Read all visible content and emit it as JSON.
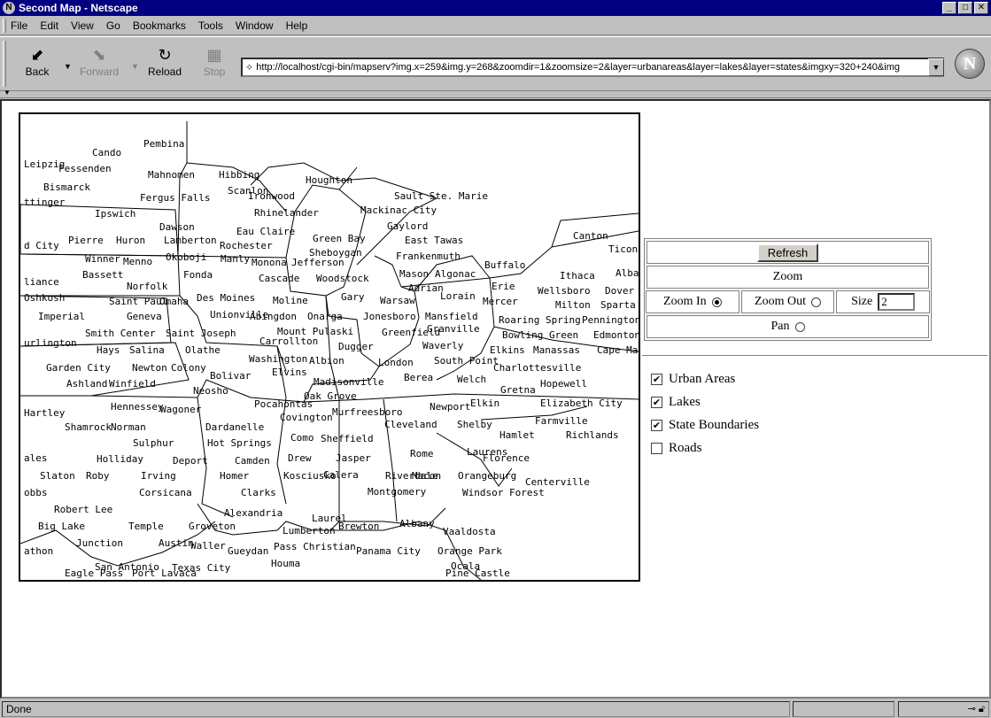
{
  "window": {
    "title": "Second Map - Netscape",
    "minimize": "_",
    "maximize": "□",
    "close": "✕"
  },
  "menu": {
    "file": "File",
    "edit": "Edit",
    "view": "View",
    "go": "Go",
    "bookmarks": "Bookmarks",
    "tools": "Tools",
    "window": "Window",
    "help": "Help"
  },
  "toolbar": {
    "back": "Back",
    "forward": "Forward",
    "reload": "Reload",
    "stop": "Stop",
    "url": "http://localhost/cgi-bin/mapserv?img.x=259&img.y=268&zoomdir=1&zoomsize=2&layer=urbanareas&layer=lakes&layer=states&imgxy=320+240&img"
  },
  "map": {
    "labels": [
      "Pembina",
      "Cando",
      "Leipzig",
      "Fessenden",
      "Mahnomen",
      "Hibbing",
      "Houghton",
      "Bismarck",
      "Fergus Falls",
      "Scanlon",
      "Ironwood",
      "Sault Ste. Marie",
      "ttinger",
      "Ipswich",
      "Rhinelander",
      "Mackinac City",
      "Dawson",
      "Eau Claire",
      "Gaylord",
      "d City",
      "Pierre",
      "Huron",
      "Lamberton",
      "Rochester",
      "Green Bay",
      "East Tawas",
      "Canton",
      "Ticond",
      "Winner",
      "Menno",
      "Okoboji",
      "Manly",
      "Monona",
      "Jefferson",
      "Sheboygan",
      "Frankenmuth",
      "Bassett",
      "Fonda",
      "Cascade",
      "Woodstock",
      "Mason",
      "Algonac",
      "Buffalo",
      "Ithaca",
      "Alban",
      "liance",
      "Norfolk",
      "Adrian",
      "Erie",
      "Wellsboro",
      "Dover",
      "Oshkosh",
      "Saint Paul",
      "Omaha",
      "Des Moines",
      "Moline",
      "Gary",
      "Warsaw",
      "Lorain",
      "Mercer",
      "Milton",
      "Sparta",
      "Imperial",
      "Geneva",
      "Unionville",
      "Abingdon",
      "Onarga",
      "Jonesboro",
      "Mansfield",
      "Roaring Spring",
      "Pennington",
      "Smith Center",
      "Saint Joseph",
      "Mount Pulaski",
      "Greenfield",
      "Granville",
      "Bowling Green",
      "Edmonton",
      "urlington",
      "Hays",
      "Salina",
      "Olathe",
      "Carrollton",
      "Dugger",
      "Waverly",
      "Elkins",
      "Manassas",
      "Cape May",
      "Washington",
      "Albion",
      "London",
      "South Point",
      "Charlottesville",
      "Garden City",
      "Newton",
      "Colony",
      "Elvins",
      "Ashland",
      "Winfield",
      "Bolivar",
      "Madisonville",
      "Berea",
      "Welch",
      "Hopewell",
      "Neosho",
      "Oak Grove",
      "Gretna",
      "Hartley",
      "Hennessey",
      "Wagoner",
      "Pocahontas",
      "Covington",
      "Murfreesboro",
      "Newport",
      "Elkin",
      "Elizabeth City",
      "Shamrock",
      "Norman",
      "Dardanelle",
      "Cleveland",
      "Shelby",
      "Farmville",
      "Sulphur",
      "Hot Springs",
      "Como",
      "Sheffield",
      "Hamlet",
      "Richlands",
      "ales",
      "Holliday",
      "Deport",
      "Camden",
      "Drew",
      "Jasper",
      "Rome",
      "Laurens",
      "Florence",
      "Slaton",
      "Roby",
      "Irving",
      "Homer",
      "Kosciusko",
      "Calera",
      "Riverdale",
      "Macon",
      "Orangeburg",
      "Centerville",
      "obbs",
      "Corsicana",
      "Clarks",
      "Montgomery",
      "Windsor Forest",
      "Robert Lee",
      "Big Lake",
      "Temple",
      "Groveton",
      "Alexandria",
      "Laurel",
      "Brewton",
      "Albany",
      "Junction",
      "Lumberton",
      "Vaaldosta",
      "Austin",
      "Waller",
      "Gueydan",
      "Pass Christian",
      "Panama City",
      "Orange Park",
      "athon",
      "San Antonio",
      "Texas City",
      "Houma",
      "Ocala",
      "Eagle Pass",
      "Port Lavaca",
      "Pine Castle"
    ]
  },
  "controls": {
    "refresh": "Refresh",
    "zoom": "Zoom",
    "zoom_in": "Zoom In",
    "zoom_out": "Zoom Out",
    "size_label": "Size",
    "size_value": "2",
    "pan": "Pan"
  },
  "layers": {
    "urban": "Urban Areas",
    "lakes": "Lakes",
    "states": "State Boundaries",
    "roads": "Roads"
  },
  "status": {
    "text": "Done"
  }
}
